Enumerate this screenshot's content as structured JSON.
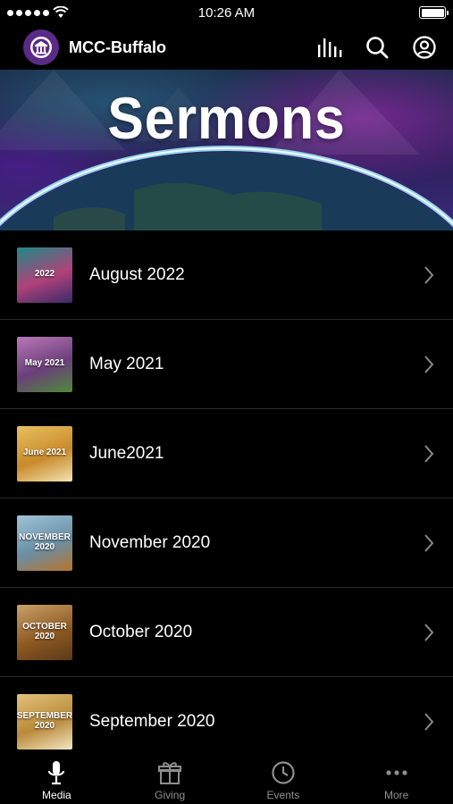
{
  "status_bar": {
    "time": "10:26 AM"
  },
  "header": {
    "title": "MCC-Buffalo"
  },
  "banner": {
    "title": "Sermons"
  },
  "sermons": [
    {
      "title": "August 2022",
      "thumb_label": "2022",
      "colors": [
        "#1e8a86",
        "#b0417a",
        "#3a2a6a"
      ]
    },
    {
      "title": "May 2021",
      "thumb_label": "May 2021",
      "colors": [
        "#b978b7",
        "#6a3f7a",
        "#4f8a3a"
      ]
    },
    {
      "title": "June2021",
      "thumb_label": "June 2021",
      "colors": [
        "#e8c060",
        "#c98a2a",
        "#f2e3b0"
      ]
    },
    {
      "title": "November 2020",
      "thumb_label": "NOVEMBER 2020",
      "colors": [
        "#9fc3d6",
        "#6a8fa6",
        "#b8742a"
      ]
    },
    {
      "title": "October 2020",
      "thumb_label": "OCTOBER 2020",
      "colors": [
        "#c9a26a",
        "#8f5a22",
        "#5a3a1a"
      ]
    },
    {
      "title": "September 2020",
      "thumb_label": "SEPTEMBER 2020",
      "colors": [
        "#e2c27a",
        "#b98a3a",
        "#f3e6c2"
      ]
    }
  ],
  "tabs": [
    {
      "label": "Media",
      "icon": "microphone-icon",
      "active": true
    },
    {
      "label": "Giving",
      "icon": "gift-icon",
      "active": false
    },
    {
      "label": "Events",
      "icon": "clock-icon",
      "active": false
    },
    {
      "label": "More",
      "icon": "more-icon",
      "active": false
    }
  ]
}
